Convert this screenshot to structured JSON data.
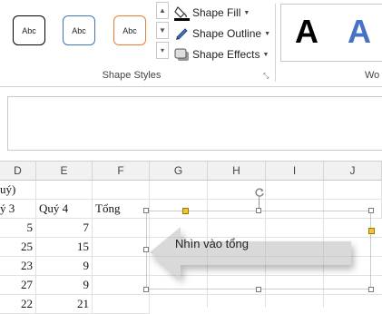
{
  "ribbon": {
    "shape_style_swatches": [
      {
        "label": "Abc",
        "border_color": "#000000"
      },
      {
        "label": "Abc",
        "border_color": "#4472c4"
      },
      {
        "label": "Abc",
        "border_color": "#ed7d31"
      }
    ],
    "shape_fill_label": "Shape Fill",
    "shape_outline_label": "Shape Outline",
    "shape_effects_label": "Shape Effects",
    "group_label": "Shape Styles",
    "next_group_label": "Wo",
    "wordart": [
      {
        "letter": "A",
        "color": "#000000"
      },
      {
        "letter": "A",
        "color": "#4472c4"
      }
    ]
  },
  "sheet": {
    "columns": [
      "D",
      "E",
      "F",
      "G",
      "H",
      "I",
      "J"
    ],
    "row_partial_header": "uý)",
    "header_row": {
      "d": "ý 3",
      "e": "Quý 4",
      "f": "Tổng"
    },
    "rows": [
      {
        "d": "5",
        "e": "7"
      },
      {
        "d": "25",
        "e": "15"
      },
      {
        "d": "23",
        "e": "9"
      },
      {
        "d": "27",
        "e": "9"
      },
      {
        "d": "22",
        "e": "21"
      }
    ]
  },
  "callout": {
    "text": "Nhìn vào tổng",
    "fill": "#ffffff"
  },
  "colors": {
    "accent_blue": "#4472c4",
    "accent_orange": "#ed7d31",
    "handle_yellow": "#f4c430"
  }
}
